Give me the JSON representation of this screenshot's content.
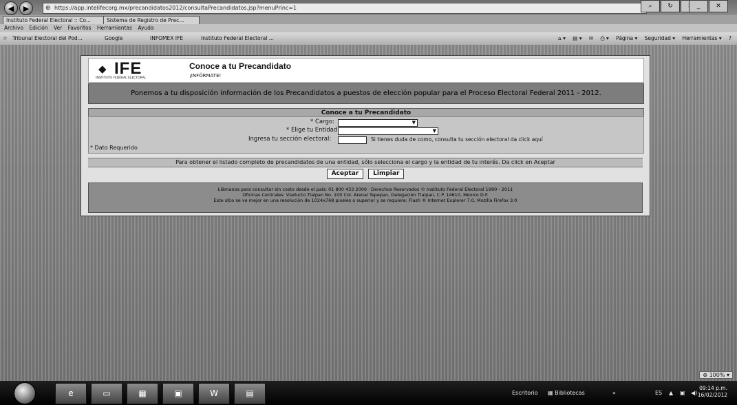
{
  "browser": {
    "url": "https://app.intelifecorg.mx/precandidatos2012/consultaPrecandidatos.jsp?menuPrinc=1",
    "tabs": [
      "Instituto Federal Electoral :: Co...",
      "Sistema de Registro de Prec..."
    ],
    "menu": [
      "Archivo",
      "Edición",
      "Ver",
      "Favoritos",
      "Herramientas",
      "Ayuda"
    ],
    "favorites": [
      "Tribunal Electoral del Pod...",
      "Google",
      "INFOMEX IFE",
      "Instituto Federal Electoral ..."
    ],
    "command_bar": [
      "Página ▾",
      "Seguridad ▾",
      "Herramientas ▾"
    ],
    "zoom": "100%"
  },
  "page": {
    "logo_text": "IFE",
    "logo_sub": "INSTITUTO FEDERAL ELECTORAL",
    "title": "Conoce a tu Precandidato",
    "subtitle": "¡INFÓRMATE!",
    "banner": "Ponemos a tu disposición información de los Precandidatos a puestos de elección popular para el Proceso Electoral Federal 2011 - 2012.",
    "form_title": "Conoce a tu Precandidato",
    "cargo_label": "* Cargo:",
    "entidad_label": "* Elige tu Entidad:",
    "seccion_label": "Ingresa tu sección electoral:",
    "seccion_hint": "Si tienes duda de como, consulta tu sección electoral da click aquí",
    "required_note": "* Dato Requerido",
    "instructions": "Para obtener el listado completo de precandidatos de una entidad, sólo selecciona el cargo y la entidad de tu interés. Da click en Aceptar",
    "accept_label": "Aceptar",
    "clear_label": "Limpiar",
    "footer_lines": [
      "Llámanos para consultar sin costo desde el país: 01 800 433 2000 · Derechos Reservados © Instituto Federal Electoral 1990 - 2011",
      "Oficinas Centrales: Viaducto Tlalpan No. 100 Col. Arenal Tepepan, Delegación Tlalpan, C.P. 14610, México D.F.",
      "Este sitio se ve mejor en una resolución de 1024x768 pixeles o superior y se requiere: Flash ® Internet Explorer 7.0, Mozilla Firefox 3.0"
    ]
  },
  "taskbar": {
    "toolbar": "Escritorio",
    "library": "Bibliotecas",
    "lang": "ES",
    "time": "09:14 p.m.",
    "date": "16/02/2012"
  }
}
